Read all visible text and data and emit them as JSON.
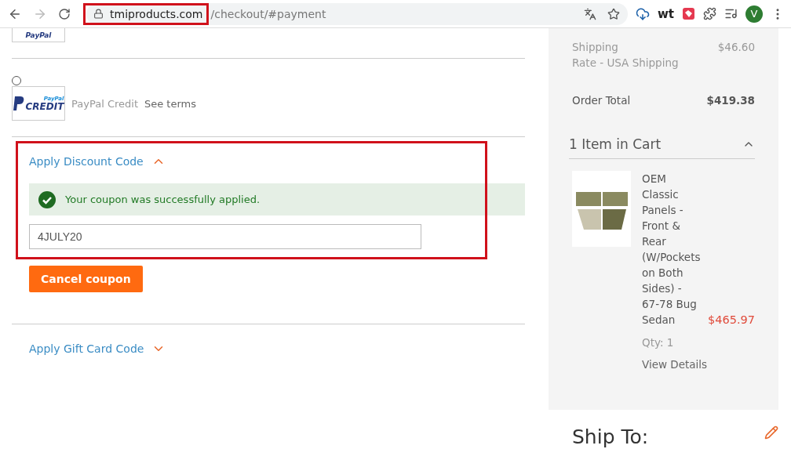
{
  "browser": {
    "url_host": "tmiproducts.com",
    "url_path": "/checkout/#payment",
    "extension_text": "wt",
    "profile_initial": "V"
  },
  "payment_methods": [
    {
      "kind": "partial",
      "logo_main": "PayPal"
    },
    {
      "kind": "full",
      "selected": false,
      "logo_top": "PayPal",
      "logo_main": "CREDIT",
      "label": "PayPal Credit",
      "link": "See terms"
    }
  ],
  "discount": {
    "title": "Apply Discount Code",
    "expanded": true,
    "message": "Your coupon was successfully applied.",
    "code_value": "4JULY20",
    "button": "Cancel coupon"
  },
  "gift_card": {
    "title": "Apply Gift Card Code",
    "expanded": false
  },
  "summary": {
    "rows": [
      {
        "kind": "normal",
        "label": "Shipping",
        "sublabel": "Rate - USA Shipping",
        "value": "$46.60"
      },
      {
        "kind": "total",
        "label": "Order Total",
        "value": "$419.38"
      }
    ]
  },
  "cart": {
    "title": "1 Item in Cart",
    "expanded": true,
    "items": [
      {
        "name": "OEM Classic Panels - Front & Rear (W/Pockets on Both Sides) - 67-78 Bug Sedan",
        "price": "$465.97",
        "qty_label": "Qty:",
        "qty": "1",
        "details_link": "View Details"
      }
    ]
  },
  "ship_to": {
    "title": "Ship To:"
  }
}
